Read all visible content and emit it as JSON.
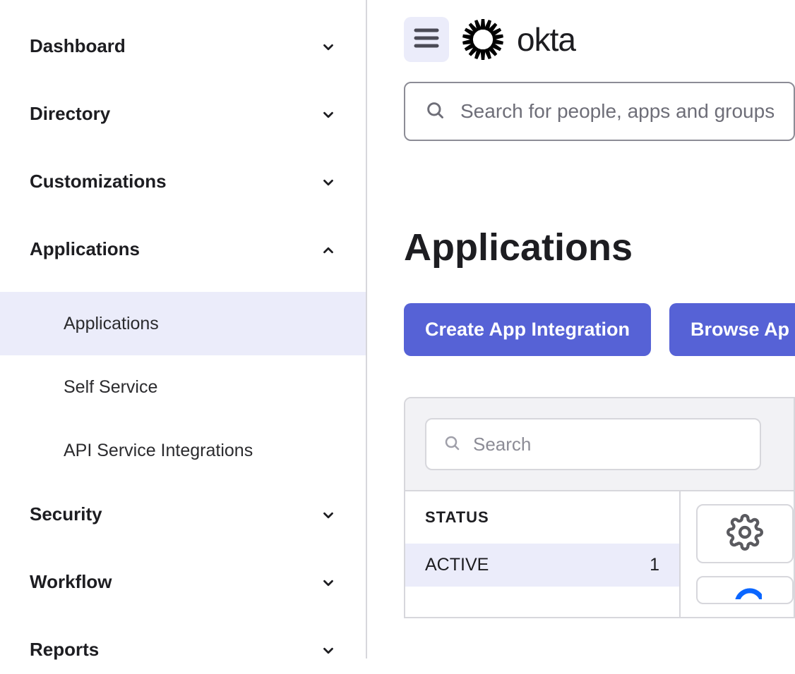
{
  "brand": {
    "name": "okta"
  },
  "global_search": {
    "placeholder": "Search for people, apps and groups"
  },
  "sidebar": {
    "items": [
      {
        "label": "Dashboard",
        "expanded": false,
        "children": []
      },
      {
        "label": "Directory",
        "expanded": false,
        "children": []
      },
      {
        "label": "Customizations",
        "expanded": false,
        "children": []
      },
      {
        "label": "Applications",
        "expanded": true,
        "children": [
          {
            "label": "Applications",
            "selected": true
          },
          {
            "label": "Self Service",
            "selected": false
          },
          {
            "label": "API Service Integrations",
            "selected": false
          }
        ]
      },
      {
        "label": "Security",
        "expanded": false,
        "children": []
      },
      {
        "label": "Workflow",
        "expanded": false,
        "children": []
      },
      {
        "label": "Reports",
        "expanded": false,
        "children": []
      }
    ]
  },
  "page": {
    "title": "Applications",
    "buttons": {
      "create": "Create App Integration",
      "browse": "Browse Ap"
    },
    "panel_search": {
      "placeholder": "Search"
    },
    "status": {
      "header": "STATUS",
      "rows": [
        {
          "label": "ACTIVE",
          "count": "1"
        }
      ]
    }
  }
}
